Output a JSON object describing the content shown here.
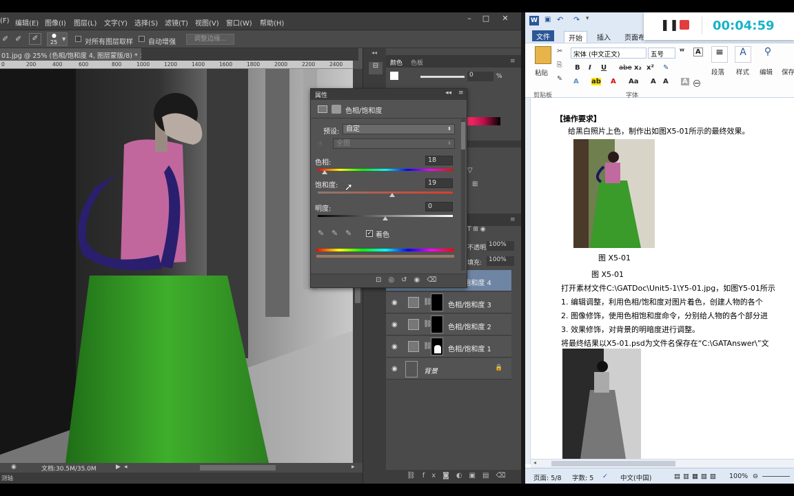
{
  "ps": {
    "menu": [
      "(F)",
      "编辑(E)",
      "图像(I)",
      "图层(L)",
      "文字(Y)",
      "选择(S)",
      "滤镜(T)",
      "视图(V)",
      "窗口(W)",
      "帮助(H)"
    ],
    "brush_size": "25",
    "sample_all_layers": "对所有图层取样",
    "auto_enhance": "自动增强",
    "refine_edge": "调整边缘...",
    "doc_tab": "01.jpg @ 25% (色相/饱和度 4, 图层蒙版/8) *",
    "ruler": [
      "0",
      "200",
      "400",
      "600",
      "800",
      "1000",
      "1200",
      "1400",
      "1600",
      "1800",
      "2000",
      "2200",
      "2400"
    ],
    "doc_size": "文档:30.5M/35.0M",
    "status_bottom": "测轴",
    "color_tabs": [
      "颜色",
      "色板"
    ],
    "color_value": "0",
    "percent": "%",
    "opacity_label": "不透明度:",
    "opacity": "100%",
    "fill_label": "填充:",
    "fill": "100%",
    "layers": [
      {
        "name": "色相/饱和度 4",
        "selected": true
      },
      {
        "name": "色相/饱和度 3",
        "selected": false
      },
      {
        "name": "色相/饱和度 2",
        "selected": false
      },
      {
        "name": "色相/饱和度 1",
        "selected": false
      },
      {
        "name": "背景",
        "selected": false
      }
    ]
  },
  "props": {
    "panel_title": "属性",
    "header": "色相/饱和度",
    "preset_label": "预设:",
    "preset_value": "自定",
    "channel_value": "全图",
    "hue_label": "色相:",
    "hue": "18",
    "sat_label": "饱和度:",
    "sat": "19",
    "light_label": "明度:",
    "light": "0",
    "colorize": "着色",
    "hue_fraction": 0.05,
    "sat_fraction": 0.55,
    "light_fraction": 0.5
  },
  "word": {
    "tabs": {
      "file": "文件",
      "home": "开始",
      "insert": "插入",
      "layout": "页面布"
    },
    "font_name": "宋体 (中文正文)",
    "font_size": "五号",
    "groups": {
      "clipboard": "剪贴板",
      "font": "字体",
      "paragraph": "段落",
      "styles": "样式",
      "edit": "编辑",
      "save": "保存"
    },
    "paste": "粘贴",
    "doc": {
      "heading": "【操作要求】",
      "line1": "给黑白照片上色，制作出如图X5-01所示的最终效果。",
      "caption1": "图 X5-01",
      "caption2": "图 X5-01",
      "line2": "打开素材文件C:\\GATDoc\\Unit5-1\\Y5-01.jpg，如图Y5-01所示",
      "step1": "1. 编辑调整，利用色相/饱和度对图片着色，创建人物的各个",
      "step2": "2. 图像修饰，使用色相饱和度命令，分别给人物的各个部分进",
      "step3": "3. 效果修饰，对背景的明暗度进行调整。",
      "line3": "将最终结果以X5-01.psd为文件名保存在“C:\\GATAnswer\\”文"
    },
    "status": {
      "page": "页面: 5/8",
      "words": "字数: 5",
      "lang": "中文(中国)",
      "zoom": "100%"
    }
  },
  "recorder": {
    "time": "00:04:59"
  }
}
